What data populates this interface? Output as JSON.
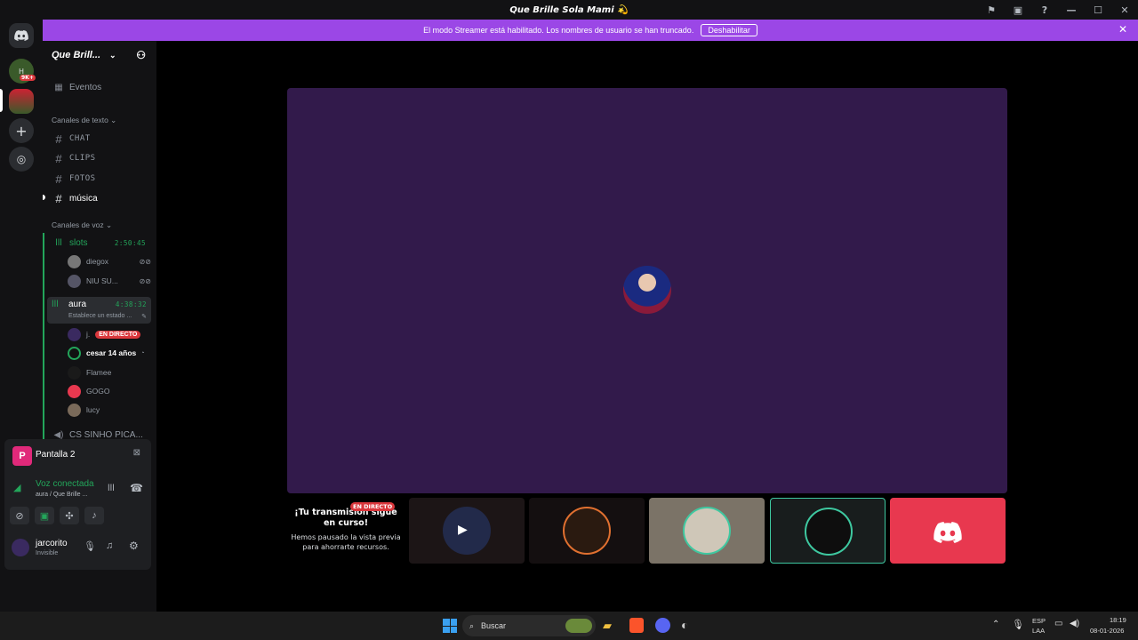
{
  "window": {
    "title": "Que Brille Sola Mami 💫"
  },
  "banner": {
    "text": "El modo Streamer está habilitado. Los nombres de usuario se han truncado.",
    "button": "Deshabilitar"
  },
  "rail": {
    "badge": "9K+",
    "h_label": "H"
  },
  "sidebar": {
    "guild_name": "Que Brill...",
    "events": "Eventos",
    "text_category": "Canales de texto",
    "text_channels": [
      "CHAT",
      "CLIPS",
      "FOTOS",
      "música"
    ],
    "voice_category": "Canales de voz",
    "slots": {
      "name": "slots",
      "timer": "2:50:45",
      "users": [
        "diegox",
        "NIU SU..."
      ]
    },
    "aura": {
      "name": "aura",
      "timer": "4:38:32",
      "status": "Establece un estado ...",
      "users": [
        "j.",
        "cesar 14 años",
        "Flamee",
        "GOGO",
        "lucy"
      ],
      "live": "EN DIRECTO"
    },
    "other_voice": "CS SINHO PICA..."
  },
  "panel": {
    "stream_initial": "P",
    "stream_title": "Pantalla 2",
    "voice_status": "Voz conectada",
    "voice_location": "aura / Que Brille ...",
    "username": "jarcorito",
    "user_status": "Invisible"
  },
  "stream_notice": {
    "badge": "EN DIRECTO",
    "title": "¡Tu transmisión sigue en curso!",
    "body": "Hemos pausado la vista previa para ahorrarte recursos."
  },
  "taskbar": {
    "search": "Buscar",
    "lang": "ESP",
    "lang2": "LAA",
    "time": "18:19",
    "date": "08-01-2026"
  },
  "colors": {
    "accent": "#9b47e6",
    "stage": "#321a4b",
    "green": "#23a55a",
    "red": "#da373c",
    "discord_red": "#e8384f"
  }
}
